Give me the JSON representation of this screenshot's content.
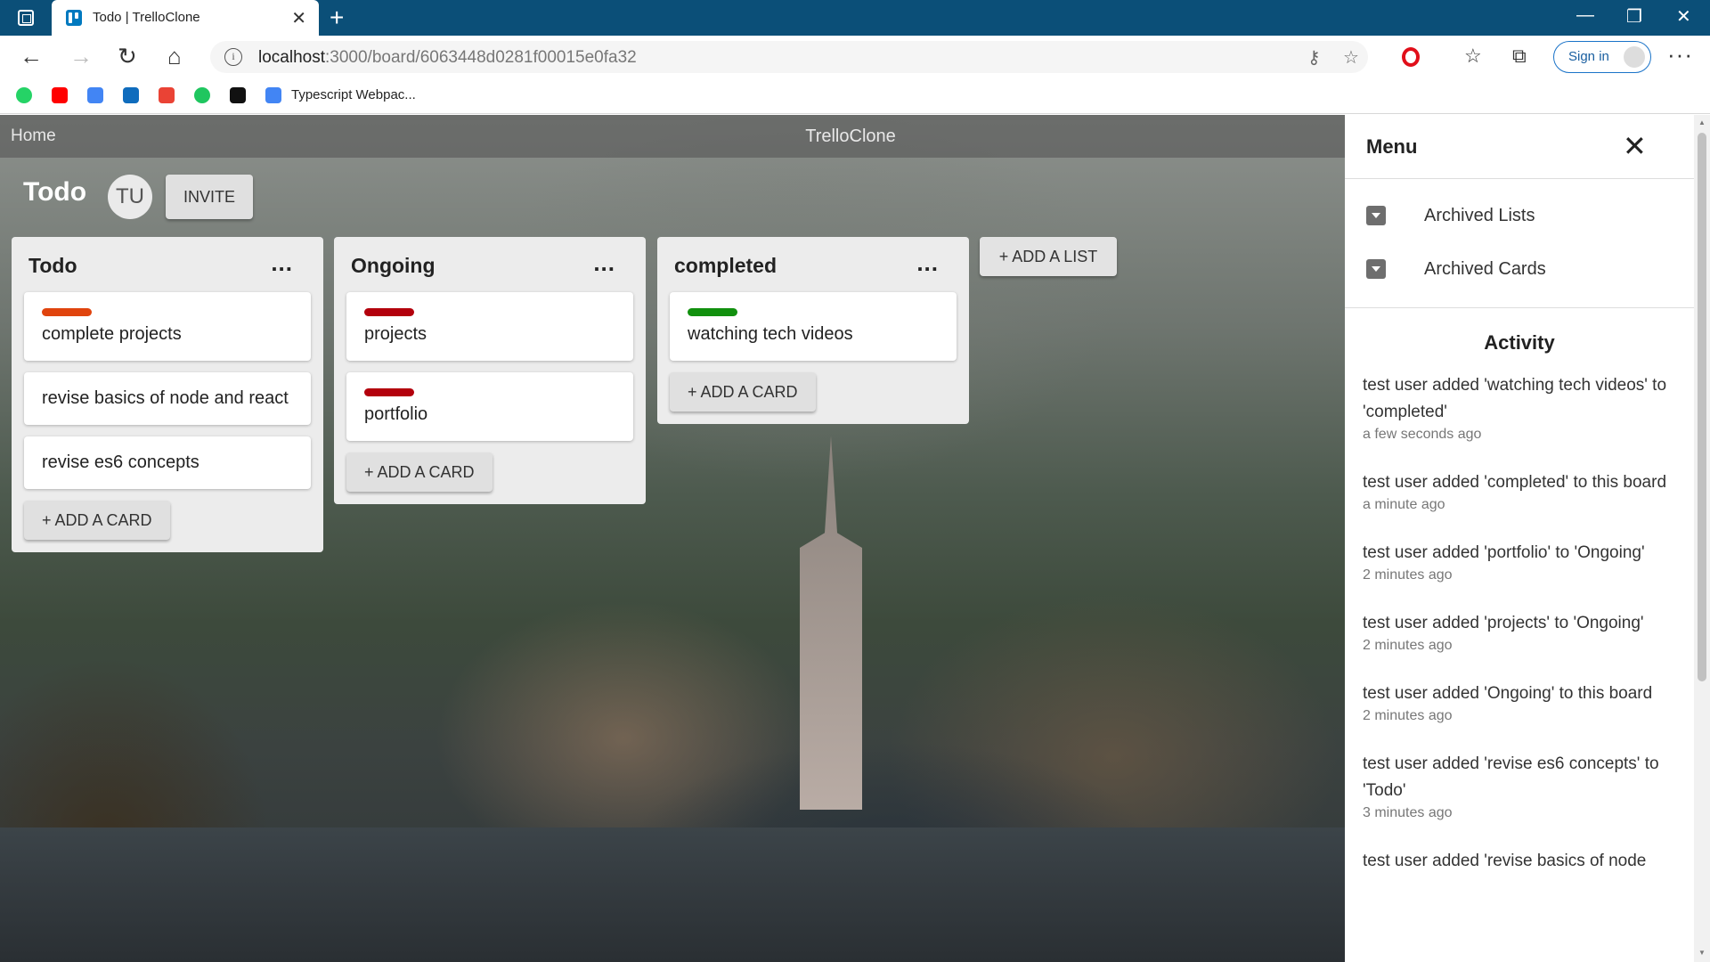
{
  "browser": {
    "tab_title": "Todo | TrelloClone",
    "url_host": "localhost",
    "url_path": ":3000/board/6063448d0281f00015e0fa32",
    "signin_label": "Sign in",
    "bookmark_label": "Typescript Webpac..."
  },
  "app": {
    "home_label": "Home",
    "brand": "TrelloClone"
  },
  "board": {
    "title": "Todo",
    "avatar_initials": "TU",
    "invite_label": "INVITE",
    "add_list_label": "+ ADD A LIST",
    "lists": [
      {
        "title": "Todo",
        "menu": "...",
        "cards": [
          {
            "text": "complete projects",
            "label_color": "#e0440e"
          },
          {
            "text": "revise basics of node and react",
            "label_color": ""
          },
          {
            "text": "revise es6 concepts",
            "label_color": ""
          }
        ],
        "add_card_label": "+ ADD A CARD"
      },
      {
        "title": "Ongoing",
        "menu": "...",
        "cards": [
          {
            "text": "projects",
            "label_color": "#b3000c"
          },
          {
            "text": "portfolio",
            "label_color": "#b3000c"
          }
        ],
        "add_card_label": "+ ADD A CARD"
      },
      {
        "title": "completed",
        "menu": "...",
        "cards": [
          {
            "text": "watching tech videos",
            "label_color": "#11900e"
          }
        ],
        "add_card_label": "+ ADD A CARD"
      }
    ]
  },
  "menu": {
    "title": "Menu",
    "items": [
      {
        "label": "Archived Lists",
        "icon": "archive-icon"
      },
      {
        "label": "Archived Cards",
        "icon": "archive-icon"
      }
    ],
    "activity_title": "Activity",
    "activity": [
      {
        "text": "test user added 'watching tech videos' to 'completed'",
        "time": "a few seconds ago"
      },
      {
        "text": "test user added 'completed' to this board",
        "time": "a minute ago"
      },
      {
        "text": "test user added 'portfolio' to 'Ongoing'",
        "time": "2 minutes ago"
      },
      {
        "text": "test user added 'projects' to 'Ongoing'",
        "time": "2 minutes ago"
      },
      {
        "text": "test user added 'Ongoing' to this board",
        "time": "2 minutes ago"
      },
      {
        "text": "test user added 'revise es6 concepts' to 'Todo'",
        "time": "3 minutes ago"
      },
      {
        "text": "test user added 'revise basics of node",
        "time": ""
      }
    ]
  }
}
